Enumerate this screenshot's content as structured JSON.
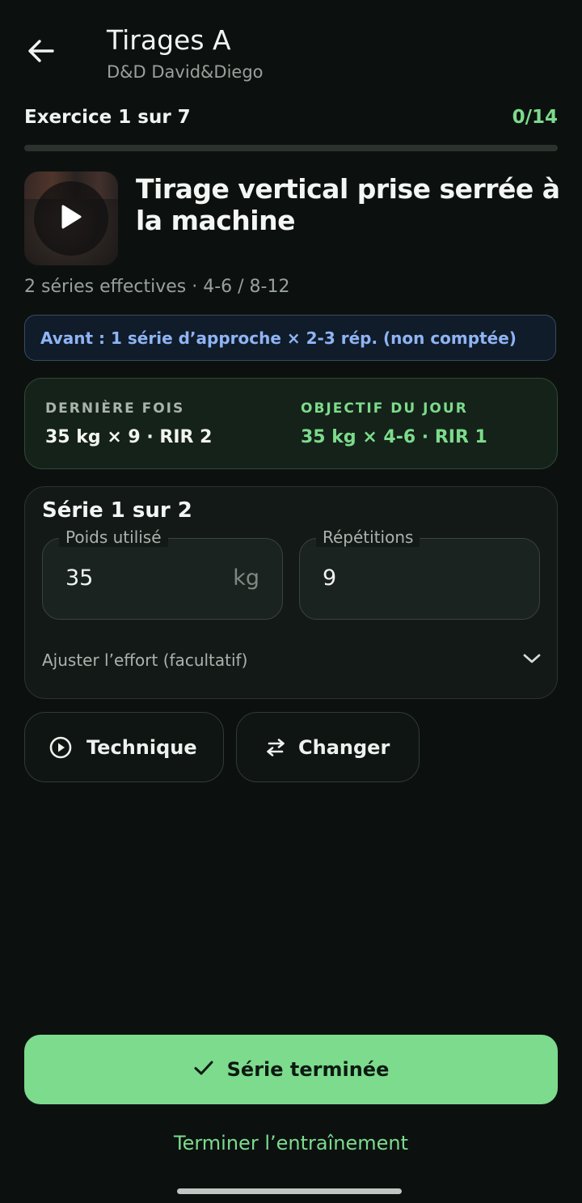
{
  "header": {
    "title": "Tirages A",
    "subtitle": "D&D David&Diego"
  },
  "progress": {
    "exercise_label": "Exercice 1 sur 7",
    "sets_done_label": "0/14",
    "fraction": 0.0
  },
  "exercise": {
    "name": "Tirage vertical prise serrée à la machine",
    "meta": "2 séries effectives · 4-6 / 8-12",
    "approach_note": "Avant : 1 série d’approche × 2-3 rép. (non comptée)"
  },
  "summary": {
    "last_label": "DERNIÈRE FOIS",
    "last_value": "35 kg × 9 · RIR 2",
    "goal_label": "OBJECTIF DU JOUR",
    "goal_value": "35 kg × 4-6 · RIR 1"
  },
  "set": {
    "title": "Série 1 sur 2",
    "weight_label": "Poids utilisé",
    "weight_value": "35",
    "weight_unit": "kg",
    "reps_label": "Répétitions",
    "reps_value": "9",
    "effort_label": "Ajuster l’effort (facultatif)"
  },
  "actions": {
    "technique_label": "Technique",
    "change_label": "Changer",
    "complete_label": "Série terminée",
    "finish_label": "Terminer l’entraînement"
  },
  "icons": {
    "back": "arrow-left-icon",
    "play": "play-icon",
    "technique": "play-circle-icon",
    "change": "swap-icon",
    "effort": "chevron-down-icon",
    "complete": "check-icon"
  },
  "colors": {
    "background": "#0c1110",
    "accent": "#7cdb8c",
    "info": "#8fb4f4",
    "muted_text": "#98a19b"
  }
}
